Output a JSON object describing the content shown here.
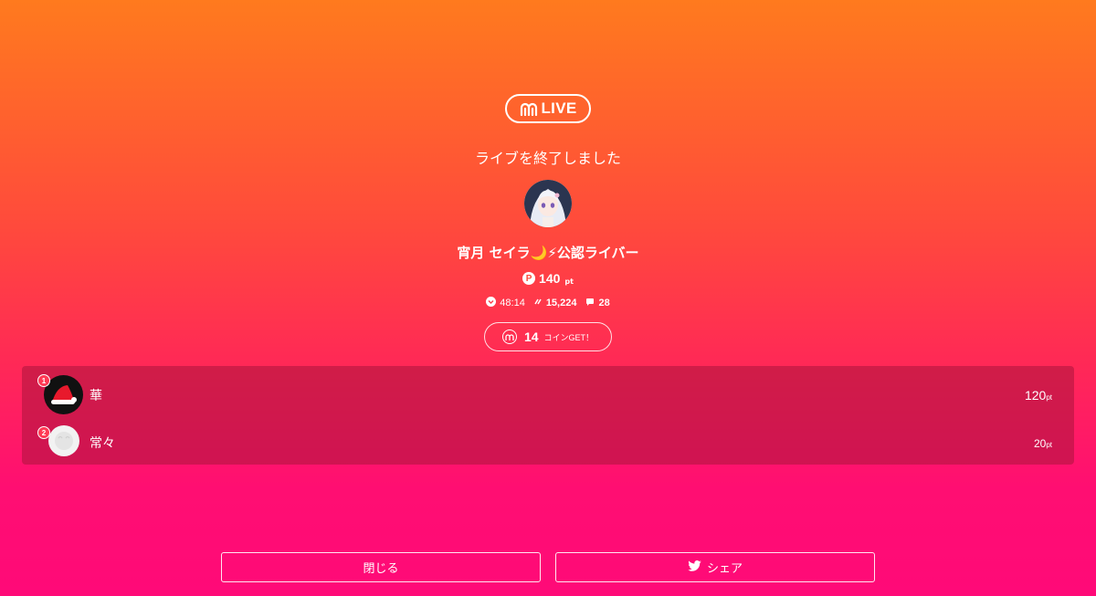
{
  "brand": {
    "logo_text": "LIVE"
  },
  "end_message": "ライブを終了しました",
  "streamer": {
    "name": "宵月 セイラ🌙⚡公認ライバー"
  },
  "points": {
    "value": "140",
    "unit": "pt"
  },
  "stats": {
    "duration": "48:14",
    "views": "15,224",
    "comments": "28"
  },
  "coins": {
    "count": "14",
    "label": "コインGET！"
  },
  "ranking": [
    {
      "rank": "1",
      "name": "華",
      "points": "120",
      "unit": "pt"
    },
    {
      "rank": "2",
      "name": "常々",
      "points": "20",
      "unit": "pt"
    }
  ],
  "buttons": {
    "close": "閉じる",
    "share": "シェア"
  },
  "colors": {
    "gradient_top": "#ff7a1e",
    "gradient_bottom": "#ff0a78",
    "panel": "#c41a48"
  },
  "icons": [
    "mirrativ-logo-icon",
    "point-icon",
    "clock-icon",
    "viewers-icon",
    "comment-icon",
    "coin-icon",
    "twitter-icon"
  ]
}
